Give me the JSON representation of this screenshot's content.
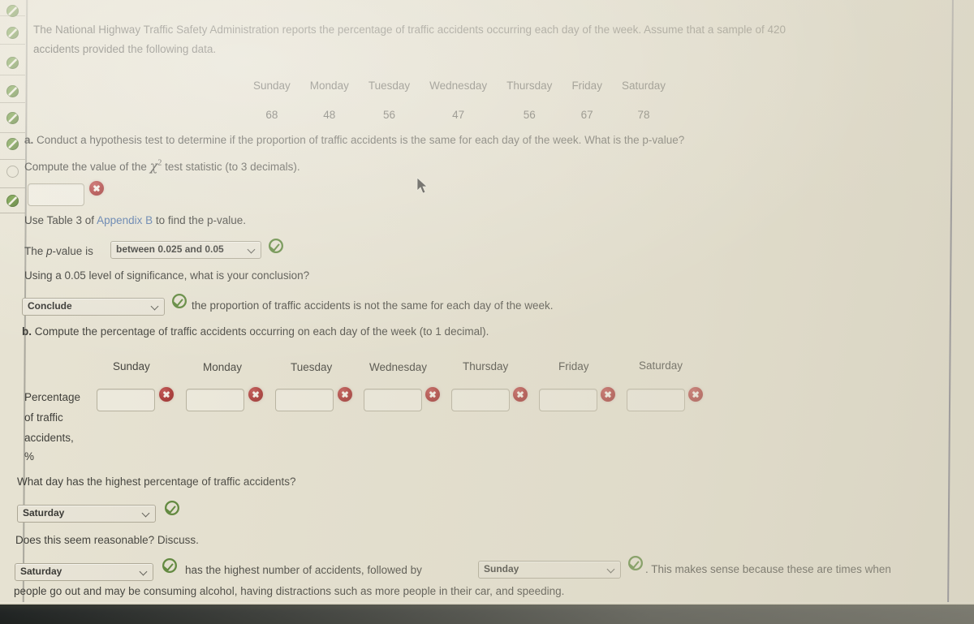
{
  "problem": {
    "intro_line1": "The National Highway Traffic Safety Administration reports the percentage of traffic accidents occurring each day of the week. Assume that a sample of 420",
    "intro_line2": "accidents provided the following data.",
    "days": [
      "Sunday",
      "Monday",
      "Tuesday",
      "Wednesday",
      "Thursday",
      "Friday",
      "Saturday"
    ],
    "counts": [
      68,
      48,
      56,
      47,
      56,
      67,
      78
    ],
    "sample_size": 420
  },
  "part_a": {
    "label": "a.",
    "prompt": "Conduct a hypothesis test to determine if the proportion of traffic accidents is the same for each day of the week. What is the p-value?",
    "compute_prompt_pre": "Compute the value of the",
    "compute_prompt_chi": "χ",
    "compute_prompt_sup": "2",
    "compute_prompt_post": "test statistic (to 3 decimals).",
    "test_statistic_value": "",
    "test_statistic_status": "wrong",
    "table_hint_pre": "Use Table 3 of",
    "table_hint_link": "Appendix B",
    "table_hint_post": "to find the p-value.",
    "pvalue_label_pre": "The",
    "pvalue_label_italic": "p",
    "pvalue_label_post": "-value is",
    "pvalue_selected": "between 0.025 and 0.05",
    "pvalue_status": "right",
    "significance_question": "Using a 0.05 level of significance, what is your conclusion?",
    "conclusion_selected": "Conclude",
    "conclusion_status": "right",
    "conclusion_tail": "the proportion of traffic accidents is not the same for each day of the week."
  },
  "part_b": {
    "label": "b.",
    "prompt": "Compute the percentage of traffic accidents occurring on each day of the week (to 1 decimal).",
    "row_label_lines": [
      "Percentage",
      "of traffic",
      "accidents,",
      "%"
    ],
    "days": [
      "Sunday",
      "Monday",
      "Tuesday",
      "Wednesday",
      "Thursday",
      "Friday",
      "Saturday"
    ],
    "percent_values": [
      "",
      "",
      "",
      "",
      "",
      "",
      ""
    ],
    "percent_status": [
      "wrong",
      "wrong",
      "wrong",
      "wrong",
      "wrong",
      "wrong",
      "wrong"
    ],
    "highest_question": "What day has the highest percentage of traffic accidents?",
    "highest_selected": "Saturday",
    "highest_status": "right",
    "reasonable_question": "Does this seem reasonable? Discuss.",
    "discuss_first_selected": "Saturday",
    "discuss_first_status": "right",
    "discuss_middle_text": "has the highest number of accidents, followed by",
    "discuss_second_selected": "Sunday",
    "discuss_second_status": "right",
    "discuss_tail_line1": ". This makes sense because these are times when",
    "discuss_tail_line2": "people go out and may be consuming alcohol, having distractions such as more people in their car, and speeding."
  },
  "sidebar": {
    "items": [
      {
        "state": "done"
      },
      {
        "state": "done"
      },
      {
        "state": "done"
      },
      {
        "state": "done"
      },
      {
        "state": "done"
      },
      {
        "state": "done"
      },
      {
        "state": "empty"
      },
      {
        "state": "done"
      }
    ]
  },
  "colors": {
    "page_background": "#e7e3d3",
    "text": "#33332f",
    "link": "#4a6fa5",
    "status_correct": "#4e7d2a",
    "status_incorrect": "#a52a2a",
    "desk": "#15191a"
  }
}
